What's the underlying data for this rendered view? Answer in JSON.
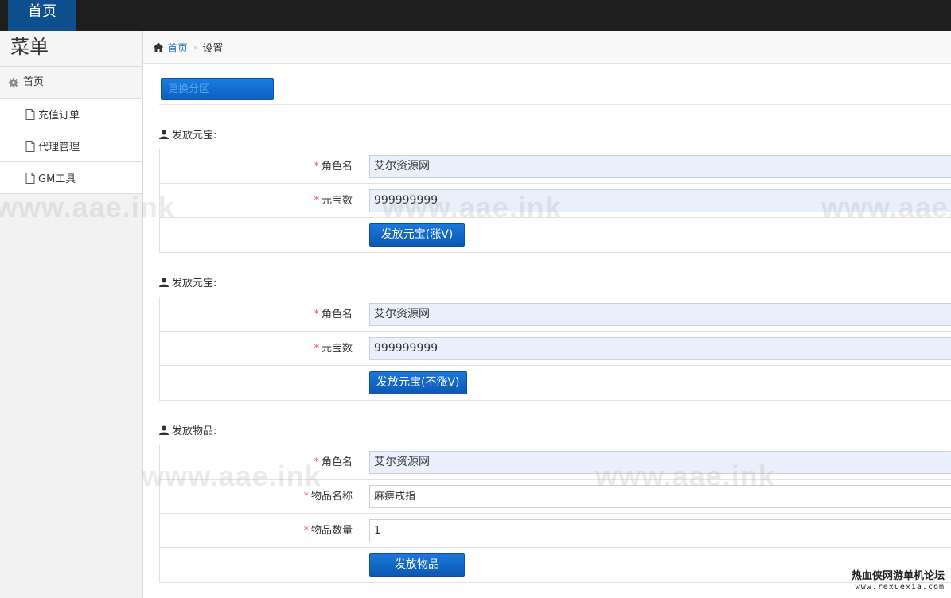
{
  "topbar": {
    "home_label": "首页"
  },
  "sidebar": {
    "title": "菜单",
    "home": "首页",
    "items": [
      {
        "label": "充值订单"
      },
      {
        "label": "代理管理"
      },
      {
        "label": "GM工具"
      }
    ]
  },
  "breadcrumb": {
    "home": "首页",
    "current": "设置"
  },
  "toolbar": {
    "switch_label": "更换分区"
  },
  "sections": [
    {
      "title": "发放元宝:",
      "fields": [
        {
          "label": "角色名",
          "value": "艾尔资源网"
        },
        {
          "label": "元宝数",
          "value": "999999999"
        }
      ],
      "button": "发放元宝(涨V)"
    },
    {
      "title": "发放元宝:",
      "fields": [
        {
          "label": "角色名",
          "value": "艾尔资源网"
        },
        {
          "label": "元宝数",
          "value": "999999999"
        }
      ],
      "button": "发放元宝(不涨V)"
    },
    {
      "title": "发放物品:",
      "fields": [
        {
          "label": "角色名",
          "value": "艾尔资源网"
        },
        {
          "label": "物品名称",
          "value": "麻痹戒指"
        },
        {
          "label": "物品数量",
          "value": "1"
        }
      ],
      "button": "发放物品"
    }
  ],
  "watermark": "www.aae.ink",
  "footer": {
    "line1": "热血侠网游单机论坛",
    "line2": "www.rexuexia.com"
  },
  "colors": {
    "accent": "#0e4f8e",
    "button": "#0c58b4",
    "required": "#e55555"
  }
}
